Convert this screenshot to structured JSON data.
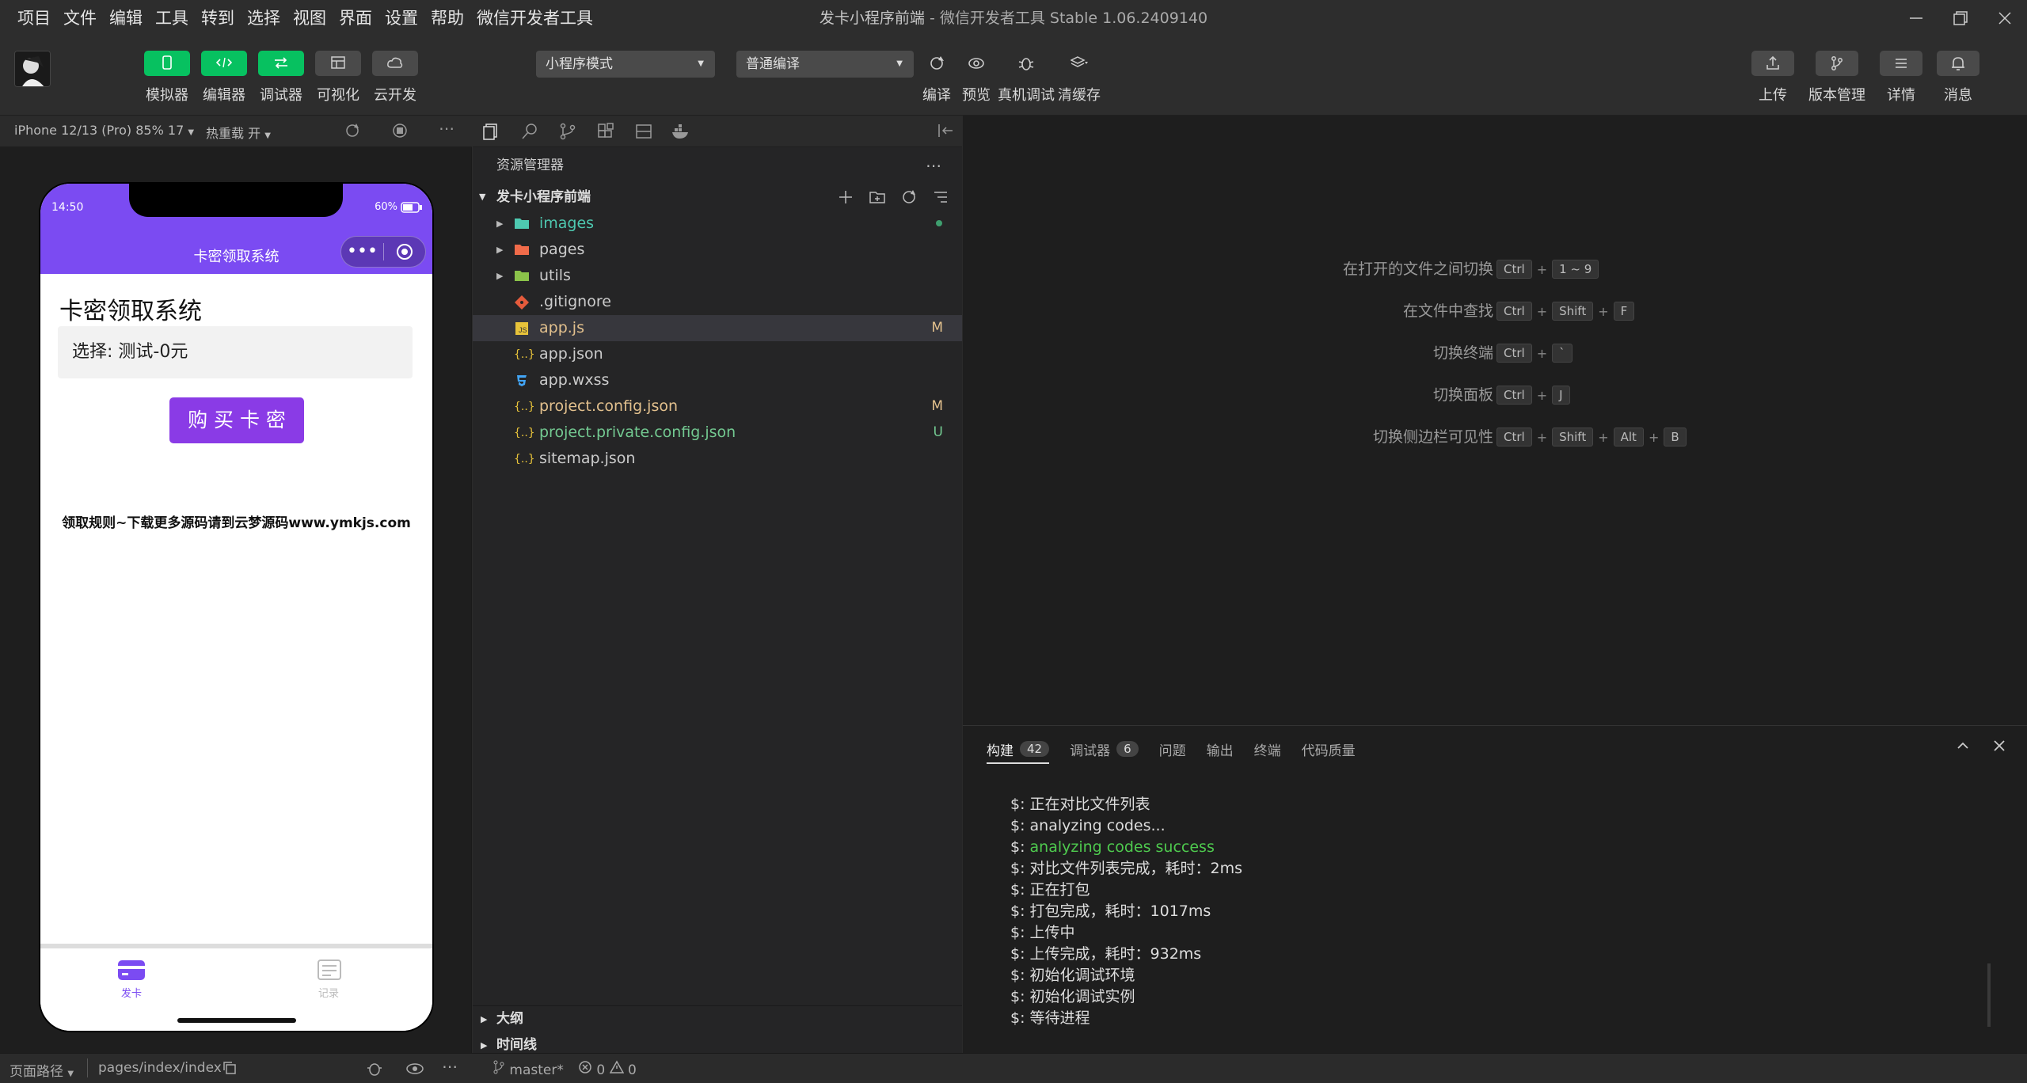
{
  "menu": [
    "项目",
    "文件",
    "编辑",
    "工具",
    "转到",
    "选择",
    "视图",
    "界面",
    "设置",
    "帮助",
    "微信开发者工具"
  ],
  "window": {
    "title_main": "发卡小程序前端",
    "title_sep": " - ",
    "title_app": "微信开发者工具 Stable 1.06.2409140"
  },
  "toolbar": {
    "left_tools": [
      {
        "label": "模拟器",
        "icon": "phone-icon"
      },
      {
        "label": "编辑器",
        "icon": "code-icon"
      },
      {
        "label": "调试器",
        "icon": "debug-icon"
      },
      {
        "label": "可视化",
        "icon": "layout-icon"
      },
      {
        "label": "云开发",
        "icon": "cloud-icon"
      }
    ],
    "mode_select": "小程序模式",
    "compile_select": "普通编译",
    "mid_tools": [
      {
        "label": "编译",
        "icon": "refresh-icon"
      },
      {
        "label": "预览",
        "icon": "eye-icon"
      },
      {
        "label": "真机调试",
        "icon": "bug-icon"
      },
      {
        "label": "清缓存",
        "icon": "layers-icon"
      }
    ],
    "right_tools": [
      {
        "label": "上传",
        "icon": "upload-icon"
      },
      {
        "label": "版本管理",
        "icon": "branch-icon"
      },
      {
        "label": "详情",
        "icon": "menu-icon"
      },
      {
        "label": "消息",
        "icon": "bell-icon"
      }
    ]
  },
  "simulator": {
    "device": "iPhone 12/13 (Pro) 85% 17",
    "hot_reload": "热重载 开",
    "phone": {
      "time": "14:50",
      "battery": "60%",
      "nav_title": "卡密领取系统",
      "heading": "卡密领取系统",
      "select_text": "选择: 测试-0元",
      "buy_button": "购 买 卡 密",
      "rules": "领取规则~下载更多源码请到云梦源码www.ymkjs.com",
      "tabs": [
        {
          "label": "发卡"
        },
        {
          "label": "记录"
        }
      ]
    }
  },
  "explorer": {
    "title": "资源管理器",
    "root": "发卡小程序前端",
    "files": [
      {
        "name": "images",
        "type": "folder",
        "color": "#4ec9b0",
        "badge": "dot",
        "badge_color": "#3f9f6f"
      },
      {
        "name": "pages",
        "type": "folder",
        "color": "#cccccc",
        "badge": "",
        "badge_color": ""
      },
      {
        "name": "utils",
        "type": "folder",
        "color": "#cccccc",
        "badge": "",
        "badge_color": ""
      },
      {
        "name": ".gitignore",
        "type": "git",
        "color": "#cccccc",
        "badge": "",
        "badge_color": ""
      },
      {
        "name": "app.js",
        "type": "js",
        "color": "#e2c08d",
        "badge": "M",
        "badge_color": "#e2c08d"
      },
      {
        "name": "app.json",
        "type": "json",
        "color": "#cccccc",
        "badge": "",
        "badge_color": ""
      },
      {
        "name": "app.wxss",
        "type": "css",
        "color": "#cccccc",
        "badge": "",
        "badge_color": ""
      },
      {
        "name": "project.config.json",
        "type": "json",
        "color": "#e2c08d",
        "badge": "M",
        "badge_color": "#e2c08d"
      },
      {
        "name": "project.private.config.json",
        "type": "json",
        "color": "#73c991",
        "badge": "U",
        "badge_color": "#73c991"
      },
      {
        "name": "sitemap.json",
        "type": "json",
        "color": "#cccccc",
        "badge": "",
        "badge_color": ""
      }
    ],
    "outline": "大纲",
    "timeline": "时间线"
  },
  "shortcuts": [
    {
      "label": "在打开的文件之间切换",
      "keys": [
        "Ctrl",
        "1 ~ 9"
      ]
    },
    {
      "label": "在文件中查找",
      "keys": [
        "Ctrl",
        "Shift",
        "F"
      ]
    },
    {
      "label": "切换终端",
      "keys": [
        "Ctrl",
        "`"
      ]
    },
    {
      "label": "切换面板",
      "keys": [
        "Ctrl",
        "J"
      ]
    },
    {
      "label": "切换侧边栏可见性",
      "keys": [
        "Ctrl",
        "Shift",
        "Alt",
        "B"
      ]
    }
  ],
  "panel": {
    "tabs": [
      {
        "label": "构建",
        "count": "42"
      },
      {
        "label": "调试器",
        "count": "6"
      },
      {
        "label": "问题",
        "count": ""
      },
      {
        "label": "输出",
        "count": ""
      },
      {
        "label": "终端",
        "count": ""
      },
      {
        "label": "代码质量",
        "count": ""
      }
    ],
    "log": [
      {
        "prefix": "$: ",
        "text": "正在对比文件列表",
        "ok": false
      },
      {
        "prefix": "$: ",
        "text": "analyzing codes...",
        "ok": false
      },
      {
        "prefix": "$: ",
        "text": "analyzing codes success",
        "ok": true
      },
      {
        "prefix": "$: ",
        "text": "对比文件列表完成，耗时：2ms",
        "ok": false
      },
      {
        "prefix": "$: ",
        "text": "正在打包",
        "ok": false
      },
      {
        "prefix": "$: ",
        "text": "打包完成，耗时：1017ms",
        "ok": false
      },
      {
        "prefix": "$: ",
        "text": "上传中",
        "ok": false
      },
      {
        "prefix": "$: ",
        "text": "上传完成，耗时：932ms",
        "ok": false
      },
      {
        "prefix": "$: ",
        "text": "初始化调试环境",
        "ok": false
      },
      {
        "prefix": "$: ",
        "text": "初始化调试实例",
        "ok": false
      },
      {
        "prefix": "$: ",
        "text": "等待进程",
        "ok": false
      }
    ]
  },
  "status": {
    "page_path_label": "页面路径",
    "page_path": "pages/index/index",
    "branch": "master*",
    "errors": "0",
    "warnings": "0"
  },
  "colors": {
    "accent_green": "#07c160",
    "nav_purple": "#7b4bf2",
    "button_purple": "#8a3be6"
  }
}
